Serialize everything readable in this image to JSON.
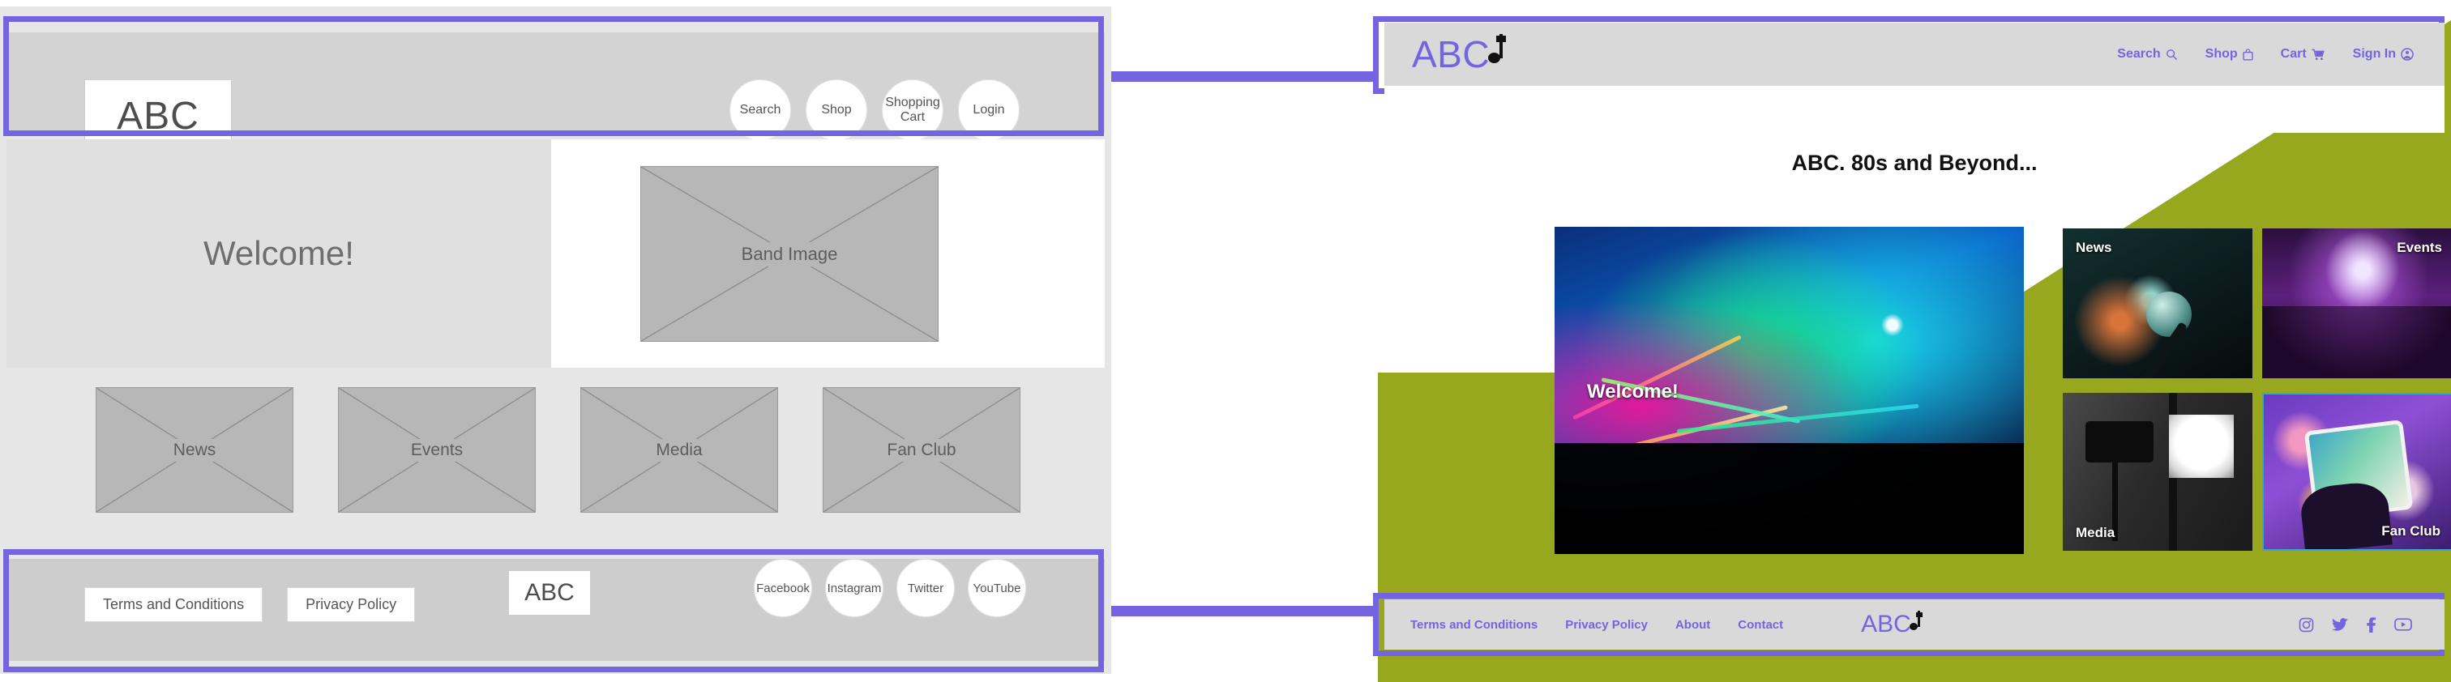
{
  "wireframe": {
    "logo_text": "ABC",
    "nav_circles": [
      {
        "label": "Search"
      },
      {
        "label": "Shop"
      },
      {
        "label": "Shopping Cart"
      },
      {
        "label": "Login"
      }
    ],
    "hero": {
      "welcome_text": "Welcome!",
      "band_image_placeholder": "Band Image"
    },
    "cards": [
      {
        "label": "News"
      },
      {
        "label": "Events"
      },
      {
        "label": "Media"
      },
      {
        "label": "Fan Club"
      }
    ],
    "footer": {
      "buttons": [
        {
          "label": "Terms and Conditions"
        },
        {
          "label": "Privacy Policy"
        }
      ],
      "logo_text": "ABC",
      "socials": [
        {
          "label": "Facebook"
        },
        {
          "label": "Instagram"
        },
        {
          "label": "Twitter"
        },
        {
          "label": "YouTube"
        }
      ]
    }
  },
  "mockup": {
    "logo_text": "ABC",
    "nav": [
      {
        "label": "Search",
        "icon": "search-icon"
      },
      {
        "label": "Shop",
        "icon": "shopping-bag-icon"
      },
      {
        "label": "Cart",
        "icon": "shopping-cart-icon"
      },
      {
        "label": "Sign In",
        "icon": "user-account-icon"
      }
    ],
    "page_title": "ABC. 80s and Beyond...",
    "tiles": [
      {
        "label": "Welcome!",
        "image": "concert-stage-lights-photo"
      },
      {
        "label": "News",
        "image": "microphone-photo"
      },
      {
        "label": "Events",
        "image": "concert-crowd-purple-photo"
      },
      {
        "label": "Media",
        "image": "camera-tripod-studio-photo"
      },
      {
        "label": "Fan Club",
        "image": "smartphone-bokeh-photo"
      }
    ],
    "footer": {
      "links": [
        {
          "label": "Terms and Conditions"
        },
        {
          "label": "Privacy Policy"
        },
        {
          "label": "About"
        },
        {
          "label": "Contact"
        }
      ],
      "logo_text": "ABC",
      "socials": [
        {
          "name": "instagram-icon"
        },
        {
          "name": "twitter-icon"
        },
        {
          "name": "facebook-icon"
        },
        {
          "name": "youtube-icon"
        }
      ]
    }
  },
  "annotation": {
    "accent_color": "#7464e0",
    "brand_purple": "#7464e0",
    "accent_green": "#97a81f",
    "arrows": [
      {
        "name": "header-mapping-arrow"
      },
      {
        "name": "footer-mapping-arrow"
      }
    ]
  }
}
